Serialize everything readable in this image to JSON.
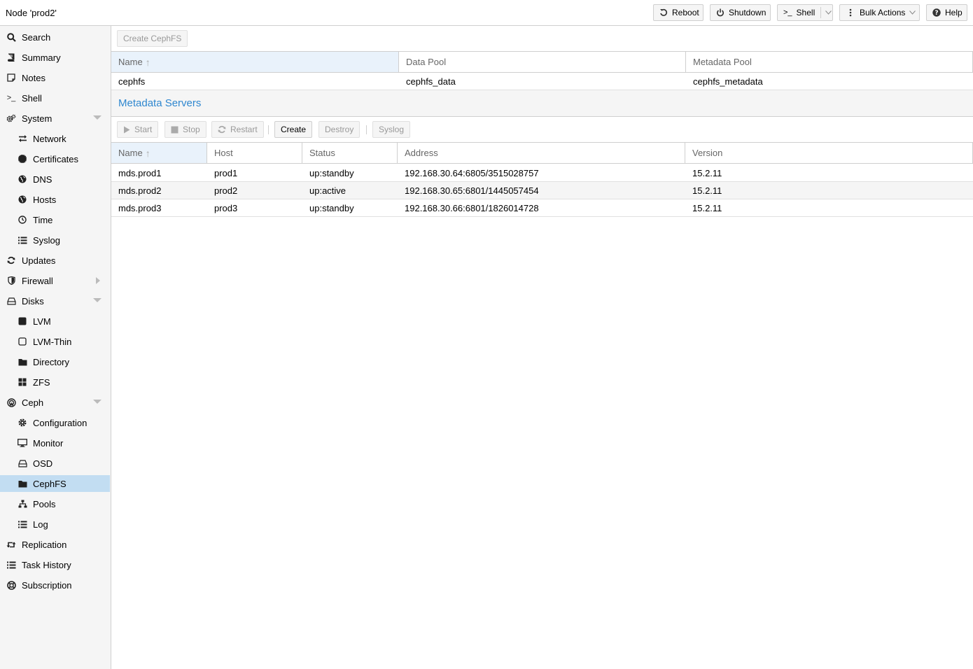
{
  "header": {
    "title": "Node 'prod2'",
    "buttons": {
      "reboot": "Reboot",
      "shutdown": "Shutdown",
      "shell": "Shell",
      "bulk_actions": "Bulk Actions",
      "help": "Help"
    }
  },
  "sidebar": {
    "items": [
      {
        "label": "Search",
        "icon": "search-icon"
      },
      {
        "label": "Summary",
        "icon": "book-icon"
      },
      {
        "label": "Notes",
        "icon": "note-icon"
      },
      {
        "label": "Shell",
        "icon": "terminal-icon"
      },
      {
        "label": "System",
        "icon": "cogs-icon"
      },
      {
        "label": "Network",
        "icon": "exchange-icon"
      },
      {
        "label": "Certificates",
        "icon": "certificate-icon"
      },
      {
        "label": "DNS",
        "icon": "globe-icon"
      },
      {
        "label": "Hosts",
        "icon": "globe-icon"
      },
      {
        "label": "Time",
        "icon": "clock-icon"
      },
      {
        "label": "Syslog",
        "icon": "list-icon"
      },
      {
        "label": "Updates",
        "icon": "refresh-icon"
      },
      {
        "label": "Firewall",
        "icon": "shield-icon"
      },
      {
        "label": "Disks",
        "icon": "hdd-icon"
      },
      {
        "label": "LVM",
        "icon": "square-icon"
      },
      {
        "label": "LVM-Thin",
        "icon": "square-outline-icon"
      },
      {
        "label": "Directory",
        "icon": "folder-icon"
      },
      {
        "label": "ZFS",
        "icon": "th-large-icon"
      },
      {
        "label": "Ceph",
        "icon": "ceph-icon"
      },
      {
        "label": "Configuration",
        "icon": "gear-icon"
      },
      {
        "label": "Monitor",
        "icon": "desktop-icon"
      },
      {
        "label": "OSD",
        "icon": "hdd-icon"
      },
      {
        "label": "CephFS",
        "icon": "folder-icon"
      },
      {
        "label": "Pools",
        "icon": "sitemap-icon"
      },
      {
        "label": "Log",
        "icon": "list-icon"
      },
      {
        "label": "Replication",
        "icon": "retweet-icon"
      },
      {
        "label": "Task History",
        "icon": "list-icon"
      },
      {
        "label": "Subscription",
        "icon": "support-icon"
      }
    ]
  },
  "cephfs": {
    "create_button": "Create CephFS",
    "columns": {
      "name": "Name",
      "data_pool": "Data Pool",
      "metadata_pool": "Metadata Pool"
    },
    "rows": [
      {
        "name": "cephfs",
        "data_pool": "cephfs_data",
        "metadata_pool": "cephfs_metadata"
      }
    ]
  },
  "mds": {
    "title": "Metadata Servers",
    "buttons": {
      "start": "Start",
      "stop": "Stop",
      "restart": "Restart",
      "create": "Create",
      "destroy": "Destroy",
      "syslog": "Syslog"
    },
    "columns": {
      "name": "Name",
      "host": "Host",
      "status": "Status",
      "address": "Address",
      "version": "Version"
    },
    "rows": [
      {
        "name": "mds.prod1",
        "host": "prod1",
        "status": "up:standby",
        "address": "192.168.30.64:6805/3515028757",
        "version": "15.2.11"
      },
      {
        "name": "mds.prod2",
        "host": "prod2",
        "status": "up:active",
        "address": "192.168.30.65:6801/1445057454",
        "version": "15.2.11"
      },
      {
        "name": "mds.prod3",
        "host": "prod3",
        "status": "up:standby",
        "address": "192.168.30.66:6801/1826014728",
        "version": "15.2.11"
      }
    ]
  },
  "colors": {
    "accent": "#2f87cf",
    "selected": "#c2ddf2"
  }
}
